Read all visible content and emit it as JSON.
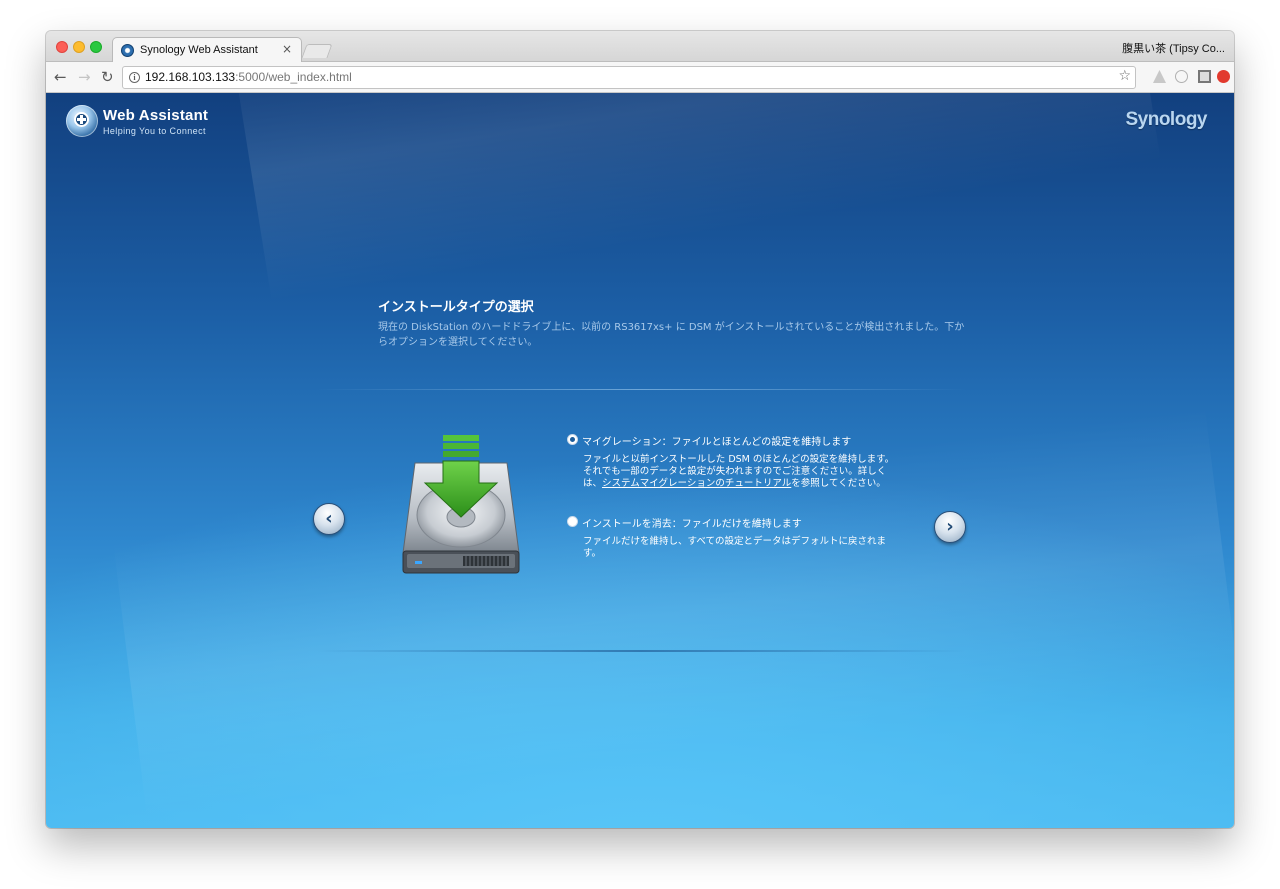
{
  "browser": {
    "tab_title": "Synology Web Assistant",
    "tab_close": "×",
    "profile_name": "腹黒い茶 (Tipsy Co...",
    "url_host": "192.168.103.133",
    "url_path": ":5000/web_index.html",
    "nav_back": "←",
    "nav_forward": "→",
    "nav_reload": "↻",
    "bookmark_star": "☆"
  },
  "header": {
    "app_title": "Web Assistant",
    "app_subtitle": "Helping You to Connect",
    "brand": "Synology"
  },
  "content": {
    "title": "インストールタイプの選択",
    "description": "現在の DiskStation のハードドライブ上に、以前の RS3617xs+ に DSM がインストールされていることが検出されました。下からオプションを選択してください。"
  },
  "options": [
    {
      "label": "マイグレーション：ファイルとほとんどの設定を維持します",
      "selected": true,
      "desc_before": "ファイルと以前インストールした DSM のほとんどの設定を維持します。それでも一部のデータと設定が失われますのでご注意ください。詳しくは、",
      "link_text": "システムマイグレーションのチュートリアル",
      "desc_after": "を参照してください。"
    },
    {
      "label": "インストールを消去：ファイルだけを維持します",
      "selected": false,
      "desc": "ファイルだけを維持し、すべての設定とデータはデフォルトに戻されます。"
    }
  ],
  "navigation": {
    "prev_label": "‹",
    "next_label": "›"
  },
  "colors": {
    "page_top": "#12407f",
    "page_bottom": "#4ab9f0",
    "download_arrow": "#3fae2a"
  }
}
